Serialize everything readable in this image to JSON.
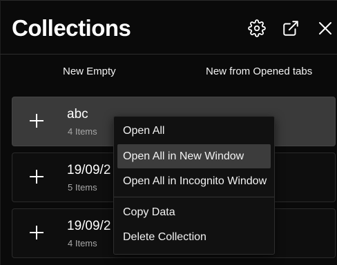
{
  "header": {
    "title": "Collections",
    "icons": [
      "settings-gear-icon",
      "external-link-icon",
      "close-icon"
    ]
  },
  "actions": {
    "new_empty": "New Empty",
    "new_from_tabs": "New from Opened tabs"
  },
  "collections": [
    {
      "name": "abc",
      "count": "4 Items",
      "state": "active"
    },
    {
      "name": "19/09/2",
      "count": "5 Items"
    },
    {
      "name": "19/09/2",
      "count": "4 Items"
    }
  ],
  "context_menu": {
    "items": [
      {
        "label": "Open All"
      },
      {
        "label": "Open All in New Window",
        "state": "hover"
      },
      {
        "label": "Open All in Incognito Window"
      },
      {
        "label": "Copy Data"
      },
      {
        "label": "Delete Collection"
      }
    ]
  },
  "colors": {
    "background": "#0a0a0a",
    "card_active": "#3a3a3a",
    "menu_background": "#111111",
    "menu_hover": "#3c3c3c",
    "muted_text": "#a8a8a8"
  }
}
